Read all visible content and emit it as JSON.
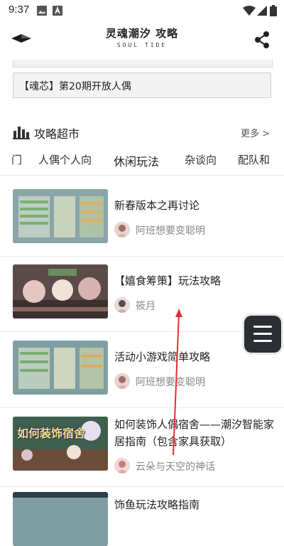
{
  "status": {
    "time": "9:37"
  },
  "header": {
    "logo_main": "灵魂潮汐 攻略",
    "logo_sub": "SOUL TIDE"
  },
  "notice": {
    "text": "【魂芯】第20期开放人偶"
  },
  "section": {
    "title": "攻略超市",
    "more_label": "更多 >"
  },
  "tabs": [
    {
      "label": "门"
    },
    {
      "label": "人偶个人向"
    },
    {
      "label": "休闲玩法"
    },
    {
      "label": "杂谈向"
    },
    {
      "label": "配队和"
    }
  ],
  "active_tab": "休闲玩法",
  "articles": [
    {
      "title": "新春版本之再讨论",
      "author": "阿班想要变聪明"
    },
    {
      "title": "【嬉食筹策】玩法攻略",
      "author": "筱月"
    },
    {
      "title": "活动小游戏简单攻略",
      "author": "阿班想要变聪明"
    },
    {
      "title": "如何装饰人偶宿舍——潮汐智能家居指南（包含家具获取）",
      "author": "云朵与天空的神话",
      "thumb_text": "如何装饰宿舍"
    },
    {
      "title": "饰鱼玩法攻略指南"
    }
  ],
  "colors": {
    "accent": "#e03030",
    "dark": "#2b2e33"
  }
}
